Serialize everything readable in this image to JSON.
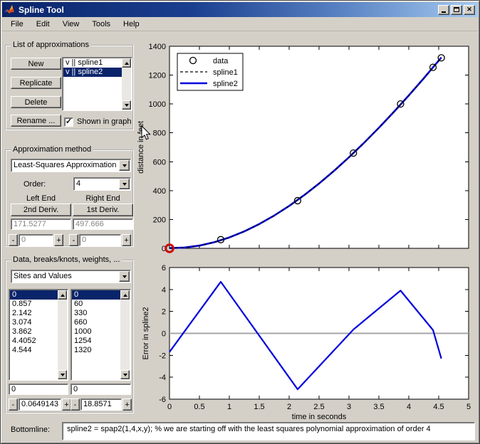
{
  "window": {
    "title": "Spline Tool"
  },
  "titlebar": {
    "icon": "matlab-logo-icon",
    "buttons": [
      {
        "name": "minimize",
        "icon": "minimize-icon"
      },
      {
        "name": "maximize",
        "icon": "maximize-icon"
      },
      {
        "name": "close",
        "icon": "close-icon",
        "glyph": "✕"
      }
    ]
  },
  "menu": {
    "items": [
      "File",
      "Edit",
      "View",
      "Tools",
      "Help"
    ]
  },
  "approx_list": {
    "group_label": "List of approximations",
    "buttons": [
      "New",
      "Replicate",
      "Delete",
      "Rename ..."
    ],
    "items": [
      {
        "label": "v || spline1",
        "selected": false
      },
      {
        "label": "v || spline2",
        "selected": true
      }
    ],
    "checkbox_label": "Shown in graph",
    "checkbox_checked": true
  },
  "approx_method": {
    "group_label": "Approximation method",
    "method_select": "Least-Squares Approximation",
    "order_label": "Order:",
    "order_value": "4",
    "left_end_label": "Left End",
    "right_end_label": "Right End",
    "left_end_button": "2nd Deriv.",
    "right_end_button": "1st Deriv.",
    "left_end_value": "171.5277",
    "right_end_value": "497.666",
    "left_spinner_value": "0",
    "right_spinner_value": "0"
  },
  "data_panel": {
    "group_label": "Data, breaks/knots, weights, ...",
    "select": "Sites and Values",
    "sites": [
      "0",
      "0.857",
      "2.142",
      "3.074",
      "3.862",
      "4.4052",
      "4.544"
    ],
    "values": [
      "0",
      "60",
      "330",
      "660",
      "1000",
      "1254",
      "1320"
    ],
    "selected_index": 0,
    "site_field": "0",
    "value_field": "0",
    "site_spinner_value": "0.0649143",
    "value_spinner_value": "18.8571"
  },
  "ui": {
    "minus": "-",
    "plus": "+"
  },
  "bottomline": {
    "label": "Bottomline:",
    "text": "spline2 = spap2(1,4,x,y); % we are starting off with the least squares polynomial approximation of order 4"
  },
  "colors": {
    "window_bg": "#d4d0c8",
    "selection": "#0a246a",
    "titlebar_left": "#0a246a",
    "titlebar_right": "#a6caf0",
    "curve_blue": "#0000dd",
    "highlight_red": "#dd0000",
    "zero_line_gray": "#a6a6a6"
  },
  "chart_data": [
    {
      "type": "line",
      "title": "",
      "xlabel": "",
      "ylabel": "distance in feet",
      "xlim": [
        0,
        5
      ],
      "ylim": [
        0,
        1400
      ],
      "xticks": [
        0,
        0.5,
        1,
        1.5,
        2,
        2.5,
        3,
        3.5,
        4,
        4.5,
        5
      ],
      "xtick_labels_shown": false,
      "yticks": [
        0,
        200,
        400,
        600,
        800,
        1000,
        1200,
        1400
      ],
      "grid": false,
      "legend": {
        "position": "top-left",
        "entries": [
          {
            "label": "data",
            "type": "marker",
            "marker": "circle",
            "color": "#000000"
          },
          {
            "label": "spline1",
            "type": "line",
            "style": "dashed",
            "color": "#000000"
          },
          {
            "label": "spline2",
            "type": "line",
            "style": "solid",
            "color": "#0000dd"
          }
        ]
      },
      "series": [
        {
          "name": "data",
          "type": "scatter",
          "marker": "circle",
          "color": "#000000",
          "x": [
            0,
            0.857,
            2.142,
            3.074,
            3.862,
            4.4052,
            4.544
          ],
          "y": [
            0,
            60,
            330,
            660,
            1000,
            1254,
            1320
          ],
          "highlight": {
            "index": 0,
            "color": "#dd0000"
          }
        },
        {
          "name": "spline2",
          "type": "line",
          "style": "solid",
          "color": "#0000dd",
          "x": [
            0,
            0.25,
            0.5,
            0.75,
            1,
            1.25,
            1.5,
            1.75,
            2,
            2.25,
            2.5,
            2.75,
            3,
            3.25,
            3.5,
            3.75,
            4,
            4.25,
            4.544
          ],
          "y": [
            1.7,
            5.1,
            18.8,
            42.3,
            75.3,
            117.4,
            168.1,
            227,
            293.7,
            367.9,
            448.9,
            536.6,
            630.5,
            730.1,
            835,
            944.9,
            1059.3,
            1177.6,
            1322.2
          ]
        },
        {
          "name": "spline1",
          "type": "line",
          "style": "dashed",
          "color": "#000000",
          "coincides_with": "spline2"
        }
      ]
    },
    {
      "type": "line",
      "title": "",
      "xlabel": "time in seconds",
      "ylabel": "Error in spline2",
      "xlim": [
        0,
        5
      ],
      "ylim": [
        -6,
        6
      ],
      "xtick_labels": [
        "0",
        "0.5",
        "1",
        "1.5",
        "2",
        "2.5",
        "3",
        "3.5",
        "4",
        "4.5",
        "5"
      ],
      "yticks": [
        -6,
        -4,
        -2,
        0,
        2,
        4,
        6
      ],
      "grid": false,
      "zero_line": {
        "y": 0,
        "color": "#a6a6a6"
      },
      "series": [
        {
          "name": "error in spline2",
          "type": "line",
          "color": "#0000dd",
          "x": [
            0,
            0.857,
            2.142,
            3.074,
            3.862,
            4.4052,
            4.544
          ],
          "y": [
            -1.7,
            4.7,
            -5.1,
            0.35,
            3.9,
            0.3,
            -2.3
          ]
        }
      ]
    }
  ]
}
